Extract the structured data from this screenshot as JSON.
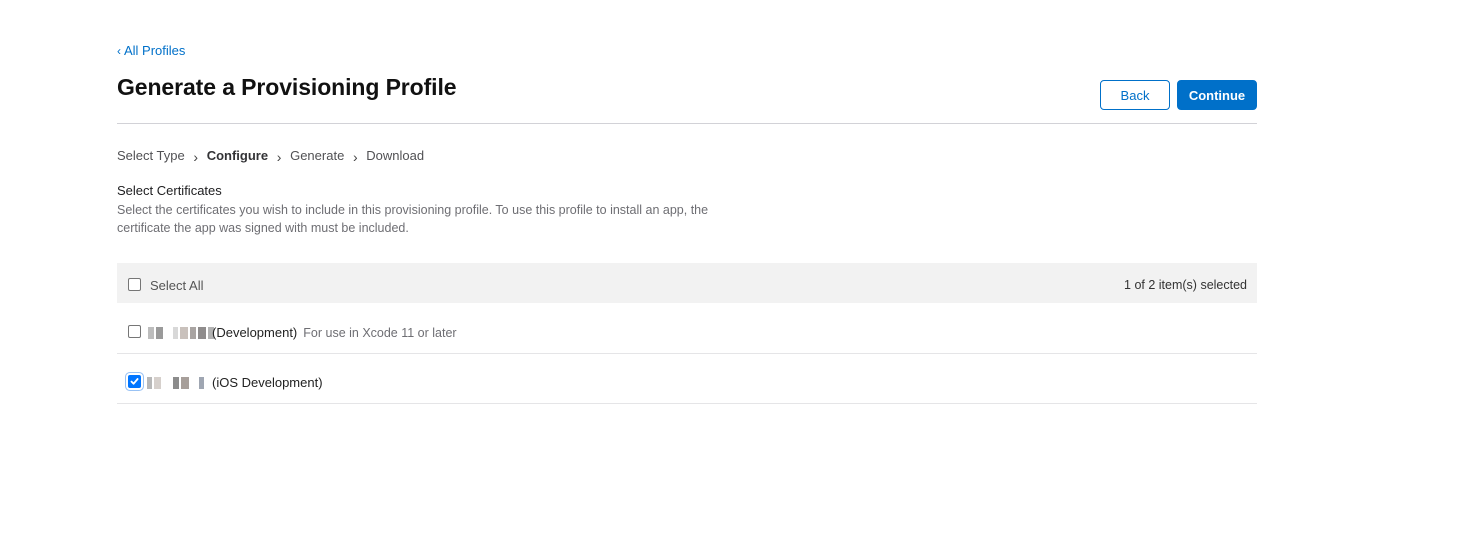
{
  "nav": {
    "back_link": "All Profiles"
  },
  "header": {
    "title": "Generate a Provisioning Profile",
    "back_button": "Back",
    "continue_button": "Continue"
  },
  "steps": [
    {
      "label": "Select Type",
      "active": false
    },
    {
      "label": "Configure",
      "active": true
    },
    {
      "label": "Generate",
      "active": false
    },
    {
      "label": "Download",
      "active": false
    }
  ],
  "section": {
    "title": "Select Certificates",
    "description": "Select the certificates you wish to include in this provisioning profile. To use this profile to install an app, the certificate the app was signed with must be included."
  },
  "table": {
    "select_all_label": "Select All",
    "select_all_checked": false,
    "selection_count": "1 of 2 item(s) selected",
    "rows": [
      {
        "name": "(Development)",
        "note": "For use in Xcode 11 or later",
        "checked": false
      },
      {
        "name": "(iOS Development)",
        "note": "",
        "checked": true
      }
    ]
  },
  "colors": {
    "accent": "#0070c9",
    "checkbox_checked": "#0075ff",
    "header_bg": "#f2f2f2"
  }
}
